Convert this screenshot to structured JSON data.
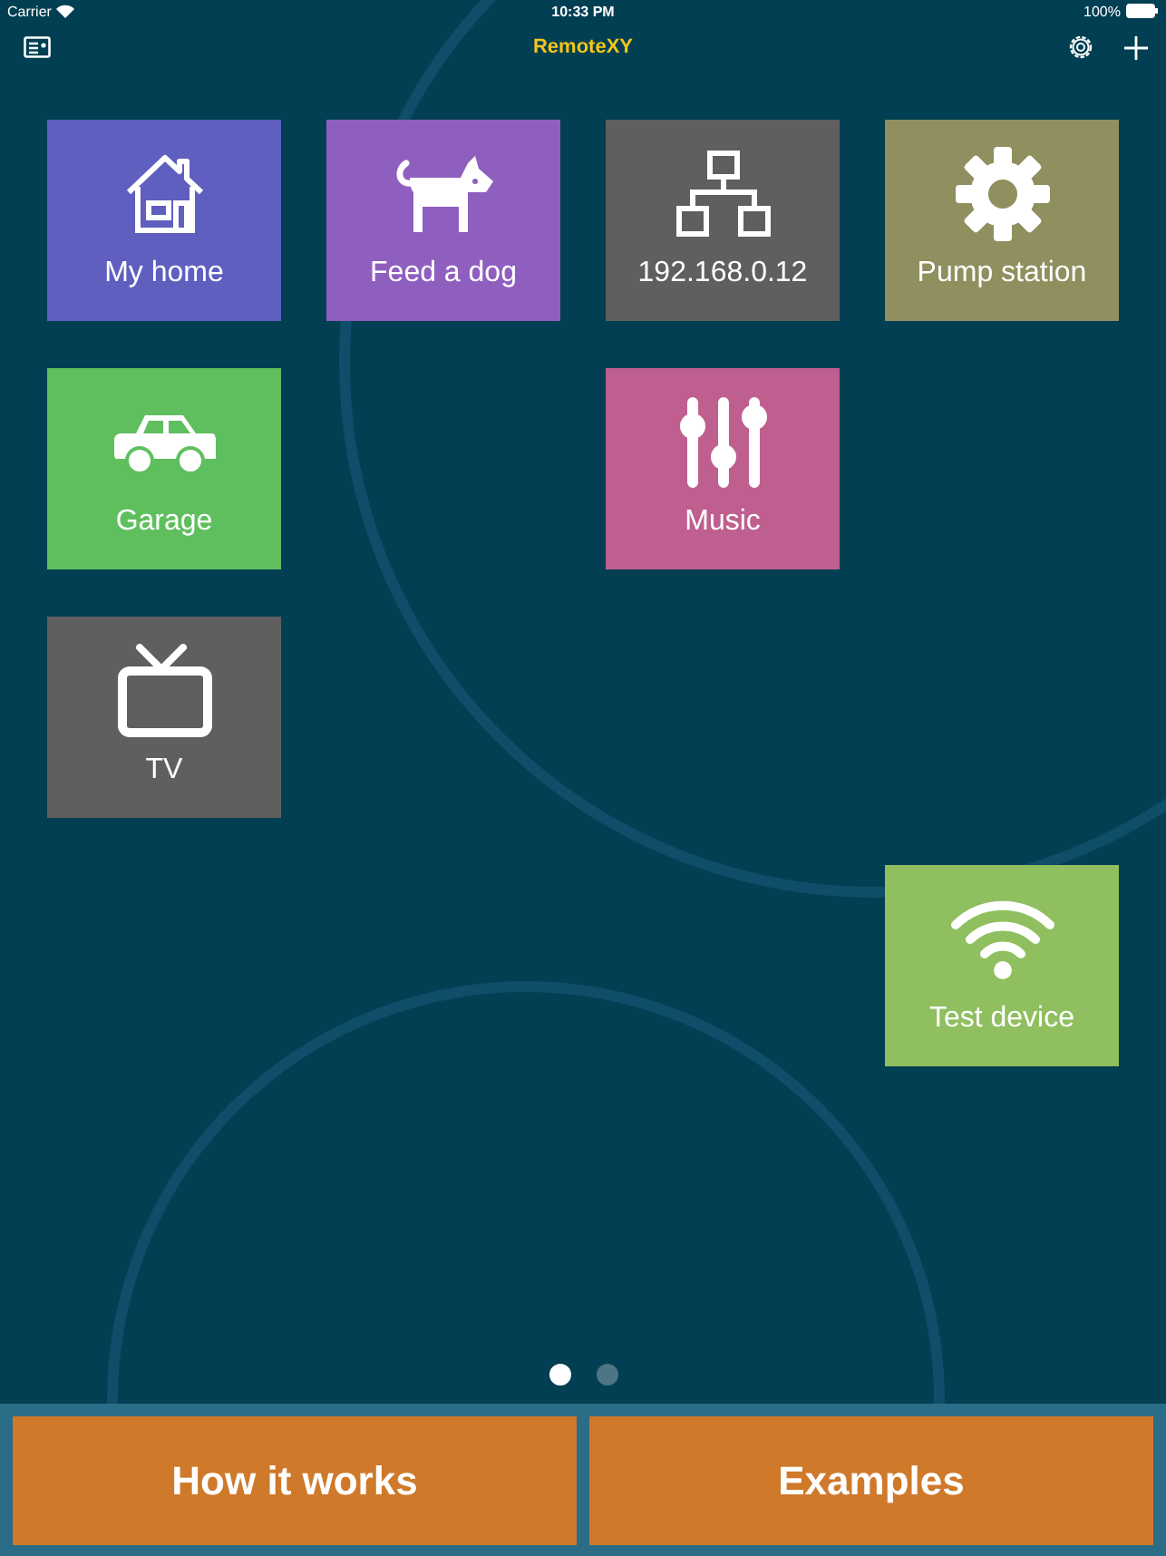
{
  "status_bar": {
    "carrier": "Carrier",
    "time": "10:33 PM",
    "battery": "100%"
  },
  "nav_bar": {
    "title": "RemoteXY"
  },
  "tiles": [
    {
      "label": "My home",
      "kind": "house",
      "color": "#5e5fbf"
    },
    {
      "label": "Feed a dog",
      "kind": "dog",
      "color": "#8f5fbf"
    },
    {
      "label": "192.168.0.12",
      "kind": "network",
      "color": "#5f5f5f"
    },
    {
      "label": "Pump station",
      "kind": "gear",
      "color": "#8f8f5f"
    },
    {
      "label": "Garage",
      "kind": "car",
      "color": "#5fbf5f"
    },
    {
      "label": "Music",
      "kind": "sliders",
      "color": "#bf5f8f"
    },
    {
      "label": "TV",
      "kind": "tv",
      "color": "#5f5f5f"
    },
    {
      "label": "Test device",
      "kind": "wifi",
      "color": "#8fbf5f"
    }
  ],
  "page_dots": [
    {
      "selected": true
    },
    {
      "selected": false
    }
  ],
  "buttons": [
    {
      "label": "How it works"
    },
    {
      "label": "Examples"
    }
  ]
}
